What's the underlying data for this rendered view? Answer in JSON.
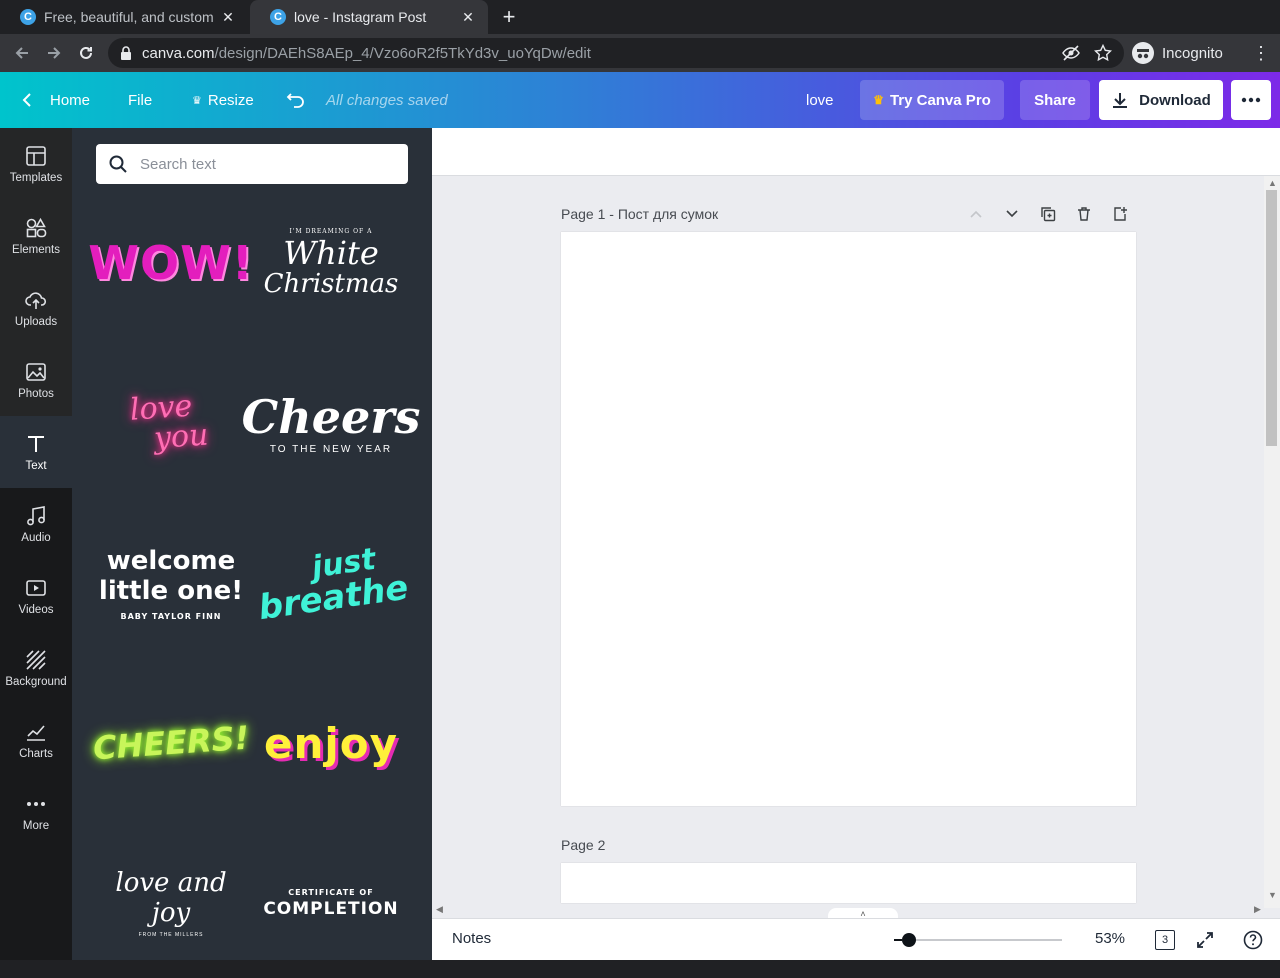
{
  "browser": {
    "tabs": [
      {
        "title": "Free, beautiful, and custom",
        "favicon": "C"
      },
      {
        "title": "love - Instagram Post",
        "favicon": "C"
      }
    ],
    "url_host": "canva.com",
    "url_path": "/design/DAEhS8AEp_4/Vzo6oR2f5TkYd3v_uoYqDw/edit",
    "profile": "Incognito"
  },
  "header": {
    "home": "Home",
    "file": "File",
    "resize": "Resize",
    "saved": "All changes saved",
    "design_title": "love",
    "try_pro": "Try Canva Pro",
    "share": "Share",
    "download": "Download"
  },
  "rail": [
    {
      "label": "Templates",
      "icon": "templates-icon"
    },
    {
      "label": "Elements",
      "icon": "elements-icon"
    },
    {
      "label": "Uploads",
      "icon": "uploads-icon"
    },
    {
      "label": "Photos",
      "icon": "photos-icon"
    },
    {
      "label": "Text",
      "icon": "text-icon"
    },
    {
      "label": "Audio",
      "icon": "audio-icon"
    },
    {
      "label": "Videos",
      "icon": "videos-icon"
    },
    {
      "label": "Background",
      "icon": "background-icon"
    },
    {
      "label": "Charts",
      "icon": "charts-icon"
    },
    {
      "label": "More",
      "icon": "more-icon"
    }
  ],
  "panel": {
    "search_placeholder": "Search text",
    "text_styles": {
      "wow": "WOW!",
      "white_top": "I'M DREAMING OF A",
      "white_1": "White",
      "white_2": "Christmas",
      "love_1": "love",
      "love_2": "you",
      "cheers": "Cheers",
      "cheers_sub": "TO THE NEW YEAR",
      "welcome_1": "welcome",
      "welcome_2": "little one!",
      "welcome_sub": "BABY TAYLOR FINN",
      "breathe_1": "just",
      "breathe_2": "breathe",
      "cheers_neon": "CHEERS!",
      "enjoy": "enjoy",
      "lovejoy": "love and joy",
      "lovejoy_sub": "FROM THE MILLERS",
      "cert_top": "CERTIFICATE OF",
      "cert_main": "COMPLETION"
    }
  },
  "editor": {
    "page1_label": "Page 1 - Пост для сумок",
    "page2_label": "Page 2",
    "notes": "Notes",
    "zoom": "53%",
    "page_count": "3"
  },
  "colors": {
    "gradient_start": "#00c4cc",
    "gradient_end": "#7d2ae8",
    "panel_bg": "#293039",
    "rail_bg": "#18191b"
  }
}
